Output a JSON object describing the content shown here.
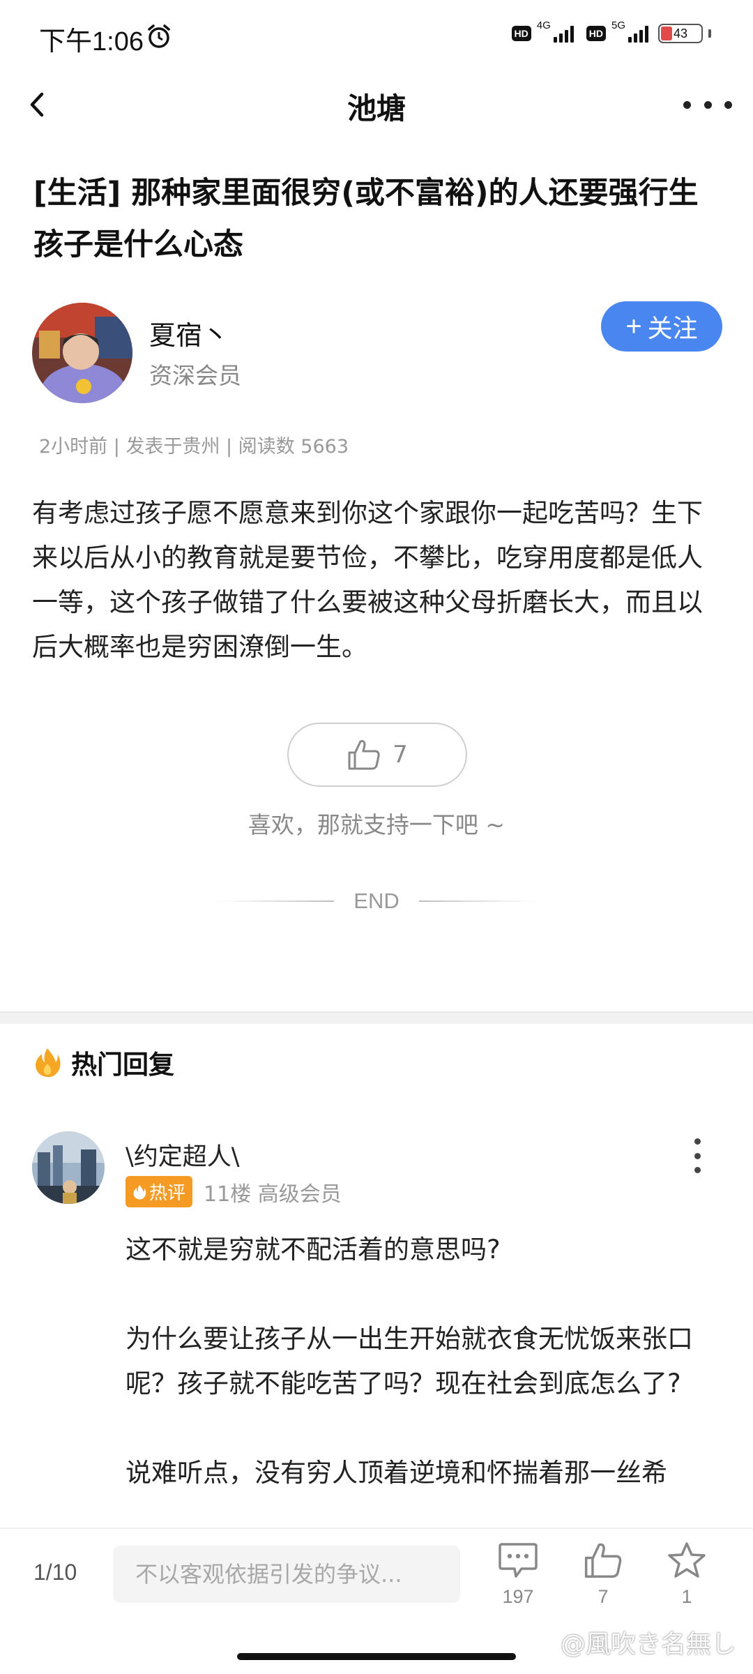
{
  "status_bar": {
    "time": "下午1:06",
    "network_1": "4G",
    "network_2": "5G",
    "hd_label": "HD",
    "battery": "43"
  },
  "nav": {
    "title": "池塘"
  },
  "post": {
    "title": "[生活] 那种家里面很穷(或不富裕)的人还要强行生孩子是什么心态",
    "author_name": "夏宿丶",
    "author_role": "资深会员",
    "follow_label": "关注",
    "meta": "2小时前 | 发表于贵州 | 阅读数 5663",
    "body": "有考虑过孩子愿不愿意来到你这个家跟你一起吃苦吗？生下来以后从小的教育就是要节俭，不攀比，吃穿用度都是低人一等，这个孩子做错了什么要被这种父母折磨长大，而且以后大概率也是穷困潦倒一生。",
    "like_count": "7",
    "support_text": "喜欢，那就支持一下吧 ~",
    "end_text": "END"
  },
  "hot_replies": {
    "title": "热门回复",
    "reply": {
      "name": "\\约定超人\\",
      "badge": "热评",
      "meta": "11楼 高级会员",
      "paragraphs": [
        "这不就是穷就不配活着的意思吗?",
        "为什么要让孩子从一出生开始就衣食无忧饭来张口呢？孩子就不能吃苦了吗？现在社会到底怎么了?",
        "说难听点，没有穷人顶着逆境和怀揣着那一丝希"
      ]
    }
  },
  "bottom_bar": {
    "page_indicator": "1/10",
    "input_placeholder": "不以客观依据引发的争议...",
    "comment_count": "197",
    "like_count": "7",
    "favorite_count": "1"
  },
  "watermark": "@風吹き名無し",
  "colors": {
    "accent": "#4a86f0",
    "hot_badge": "#f59a23"
  }
}
